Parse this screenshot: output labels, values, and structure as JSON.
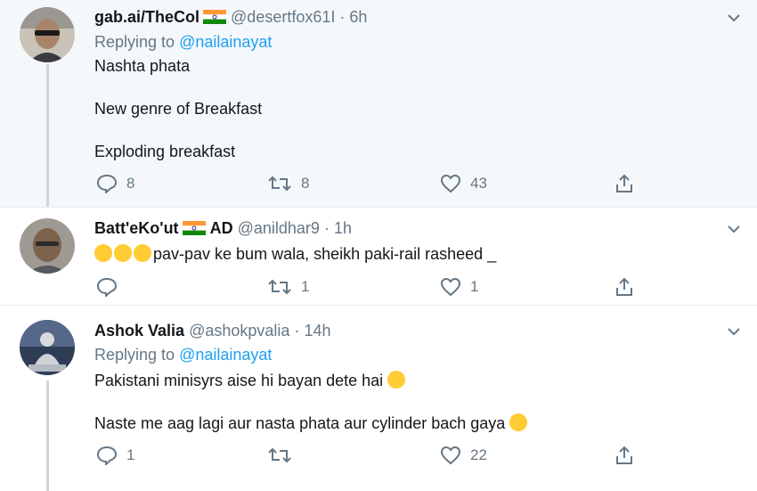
{
  "tweets": [
    {
      "name": "gab.ai/TheCol",
      "handle": "@desertfox61I",
      "dot": "·",
      "time": "6h",
      "replying_label": "Replying to",
      "replying_to": "@nailainayat",
      "lines": [
        "Nashta phata",
        "New genre of Breakfast",
        "Exploding breakfast"
      ],
      "replies": "8",
      "retweets": "8",
      "likes": "43"
    },
    {
      "name": "Batt'eKo'ut",
      "name_suffix": "AD",
      "handle": "@anildhar9",
      "dot": "·",
      "time": "1h",
      "text": "pav-pav ke bum wala, sheikh paki-rail rasheed _",
      "replies": "",
      "retweets": "1",
      "likes": "1"
    },
    {
      "name": "Ashok Valia",
      "handle": "@ashokpvalia",
      "dot": "·",
      "time": "14h",
      "replying_label": "Replying to",
      "replying_to": "@nailainayat",
      "lines": [
        "Pakistani minisyrs aise hi bayan dete hai",
        "Naste me aag lagi aur nasta phata aur cylinder bach gaya"
      ],
      "replies": "1",
      "retweets": "",
      "likes": "22"
    }
  ],
  "colors": {
    "link": "#1da1f2",
    "muted": "#657786",
    "highlight_bg": "#f5f8fa",
    "divider": "#e6ecf0"
  },
  "icons": [
    "reply-icon",
    "retweet-icon",
    "like-icon",
    "share-icon",
    "chevron-down-icon",
    "india-flag-icon",
    "laughing-emoji-icon",
    "winking-emoji-icon",
    "sweat-smile-emoji-icon",
    "rofl-emoji-icon"
  ]
}
